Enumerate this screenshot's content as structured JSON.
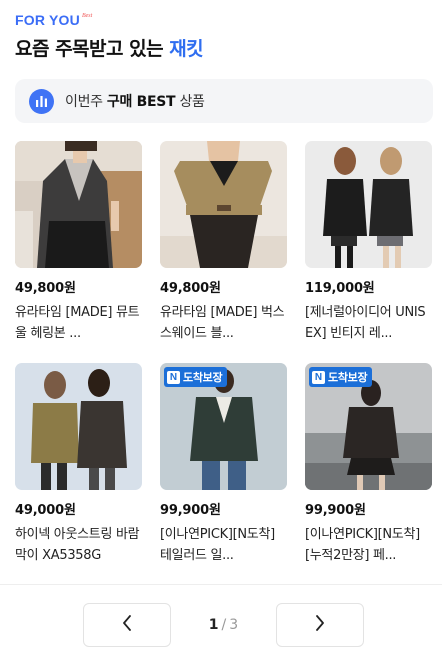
{
  "header": {
    "brand": "FOR YOU",
    "brand_sup": "Best",
    "title_prefix": "요즘 주목받고 있는 ",
    "title_highlight": "재킷"
  },
  "banner": {
    "icon": "bar-chart-icon",
    "text_prefix": "이번주 ",
    "text_bold": "구매 BEST",
    "text_suffix": " 상품"
  },
  "products": [
    {
      "price": "49,800원",
      "name": "유라타임 [MADE] 뮤트 울 헤링본 ...",
      "badge": ""
    },
    {
      "price": "49,800원",
      "name": "유라타임 [MADE] 벅스 스웨이드 블...",
      "badge": ""
    },
    {
      "price": "119,000원",
      "name": "[제너럴아이디어 UNISEX] 빈티지 레...",
      "badge": ""
    },
    {
      "price": "49,000원",
      "name": "하이넥 아웃스트링 바람막이 XA5358G",
      "badge": ""
    },
    {
      "price": "99,900원",
      "name": "[이나연PICK][N도착] 테일러드 일...",
      "badge": "도착보장"
    },
    {
      "price": "99,900원",
      "name": "[이나연PICK][N도착][누적2만장] 페...",
      "badge": "도착보장"
    }
  ],
  "badge_letter": "N",
  "pagination": {
    "current": "1",
    "separator": "/",
    "total": "3",
    "prev_icon": "chevron-left-icon",
    "next_icon": "chevron-right-icon"
  }
}
